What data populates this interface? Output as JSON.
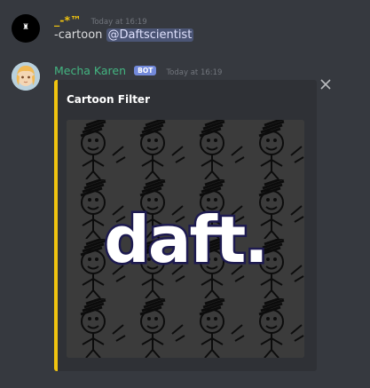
{
  "messages": [
    {
      "author": "_-*™",
      "timestamp": "Today at 16:19",
      "avatar_icon": "black-circle-avatar",
      "content_text": "-cartoon ",
      "mention": "@Daftscientist"
    },
    {
      "author": "Mecha Karen",
      "badge": "BOT",
      "timestamp": "Today at 16:19",
      "avatar_icon": "anime-girl-avatar",
      "embed": {
        "title": "Cartoon Filter",
        "accent_color": "#f1c40f",
        "image_text": "daft."
      }
    }
  ],
  "colors": {
    "background": "#36393f",
    "embed_bg": "#2f3136",
    "bot_badge": "#7289da",
    "username1": "#f1c40f",
    "username2": "#43b581"
  }
}
